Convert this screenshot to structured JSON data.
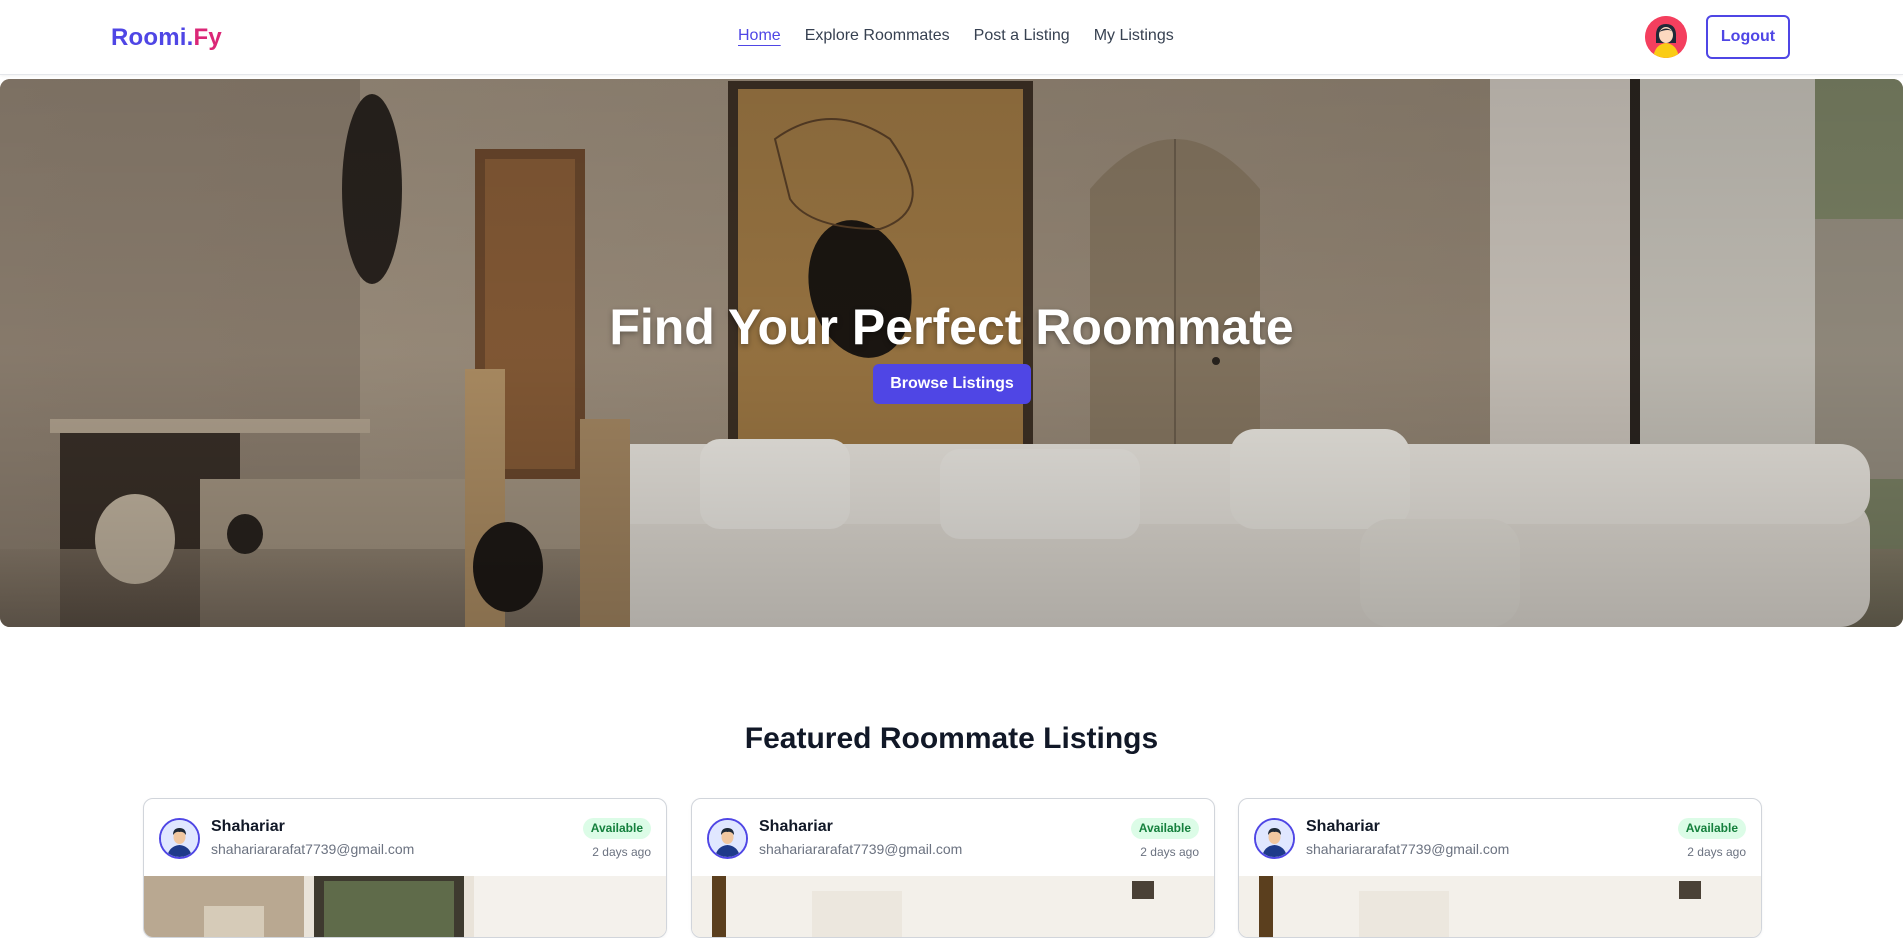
{
  "navbar": {
    "logo_part1": "Roomi.",
    "logo_part2": "Fy",
    "links": [
      {
        "label": "Home",
        "active": true
      },
      {
        "label": "Explore Roommates",
        "active": false
      },
      {
        "label": "Post a Listing",
        "active": false
      },
      {
        "label": "My Listings",
        "active": false
      }
    ],
    "avatar_icon": "user-avatar-icon",
    "logout_label": "Logout"
  },
  "hero": {
    "title": "Find Your Perfect Roommate",
    "button_label": "Browse Listings"
  },
  "featured": {
    "title": "Featured Roommate Listings",
    "cards": [
      {
        "name": "Shahariar",
        "email": "shahariararafat7739@gmail.com",
        "status": "Available",
        "time": "2 days ago"
      },
      {
        "name": "Shahariar",
        "email": "shahariararafat7739@gmail.com",
        "status": "Available",
        "time": "2 days ago"
      },
      {
        "name": "Shahariar",
        "email": "shahariararafat7739@gmail.com",
        "status": "Available",
        "time": "2 days ago"
      }
    ]
  },
  "colors": {
    "primary": "#4f46e5",
    "accent": "#db2777",
    "badge_bg": "#dcfce7",
    "badge_text": "#15803d"
  }
}
